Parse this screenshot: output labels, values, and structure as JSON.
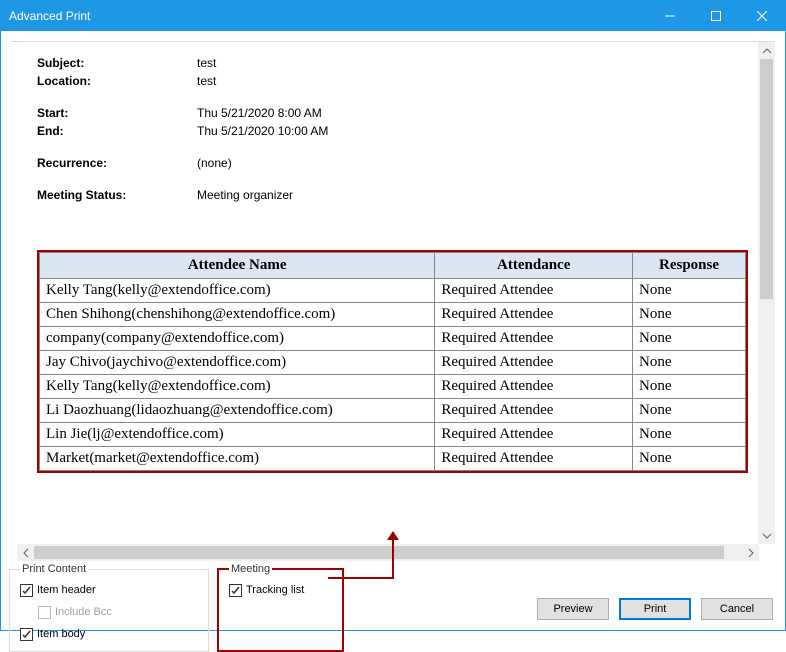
{
  "window": {
    "title": "Advanced Print"
  },
  "header": {
    "subject_label": "Subject:",
    "subject_value": "test",
    "location_label": "Location:",
    "location_value": "test",
    "start_label": "Start:",
    "start_value": "Thu 5/21/2020 8:00 AM",
    "end_label": "End:",
    "end_value": "Thu 5/21/2020 10:00 AM",
    "recurrence_label": "Recurrence:",
    "recurrence_value": "(none)",
    "status_label": "Meeting Status:",
    "status_value": "Meeting organizer"
  },
  "table": {
    "columns": {
      "name": "Attendee Name",
      "attendance": "Attendance",
      "response": "Response"
    },
    "rows": [
      {
        "name": "Kelly Tang(kelly@extendoffice.com)",
        "attendance": "Required Attendee",
        "response": "None"
      },
      {
        "name": "Chen Shihong(chenshihong@extendoffice.com)",
        "attendance": "Required Attendee",
        "response": "None"
      },
      {
        "name": "company(company@extendoffice.com)",
        "attendance": "Required Attendee",
        "response": "None"
      },
      {
        "name": "Jay Chivo(jaychivo@extendoffice.com)",
        "attendance": "Required Attendee",
        "response": "None"
      },
      {
        "name": "Kelly Tang(kelly@extendoffice.com)",
        "attendance": "Required Attendee",
        "response": "None"
      },
      {
        "name": "Li Daozhuang(lidaozhuang@extendoffice.com)",
        "attendance": "Required Attendee",
        "response": "None"
      },
      {
        "name": "Lin Jie(lj@extendoffice.com)",
        "attendance": "Required Attendee",
        "response": "None"
      },
      {
        "name": "Market(market@extendoffice.com)",
        "attendance": "Required Attendee",
        "response": "None"
      }
    ]
  },
  "groups": {
    "print_content": {
      "legend": "Print Content",
      "item_header": "Item header",
      "include_bcc": "Include Bcc",
      "item_body": "Item body"
    },
    "meeting": {
      "legend": "Meeting",
      "tracking_list": "Tracking list"
    }
  },
  "buttons": {
    "preview": "Preview",
    "print": "Print",
    "cancel": "Cancel"
  }
}
